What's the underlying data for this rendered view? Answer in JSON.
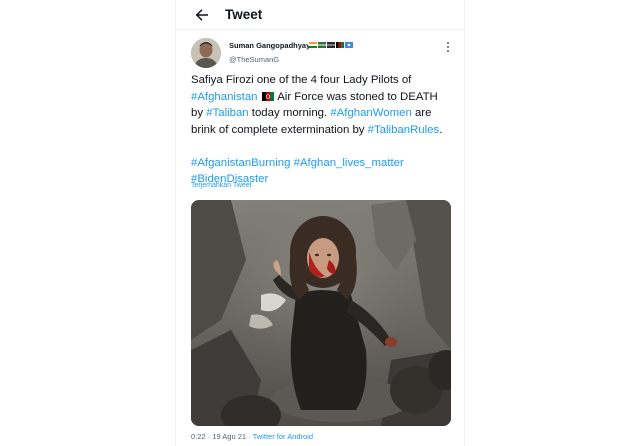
{
  "header": {
    "title": "Tweet"
  },
  "author": {
    "name": "Suman Gangopadhyay",
    "handle": "@TheSumanG",
    "name_flags": [
      "flag-icon-india",
      "flag-icon-green-banner",
      "flag-icon-dark-banner",
      "flag-icon-afghanistan",
      "flag-icon-somalia"
    ]
  },
  "tweet": {
    "line1": "Safiya Firozi one of the 4 four Lady Pilots of",
    "line2_tag": "#Afghanistan",
    "line2_rest": " Air Force was stoned to DEATH",
    "line3_pre": "by ",
    "line3_tag1": "#Taliban",
    "line3_mid": " today morning. ",
    "line3_tag2": "#AfghanWomen",
    "line3_post": " are",
    "line4_pre": "brink of complete extermination by ",
    "line4_tag": "#TalibanRules",
    "line4_post": ".",
    "line5_tag1": "#AfganistanBurning",
    "line5_tag2": "#Afghan_lives_matter",
    "line6_tag": "#BidenDisaster"
  },
  "translate_label": "Terjemahkan Tweet",
  "meta": {
    "time": "0:22",
    "separator": " · ",
    "date": "19 Agu 21",
    "source": "Twitter for Android"
  },
  "colors": {
    "link": "#1d9bf0",
    "text": "#0f1419",
    "secondary": "#536471"
  }
}
